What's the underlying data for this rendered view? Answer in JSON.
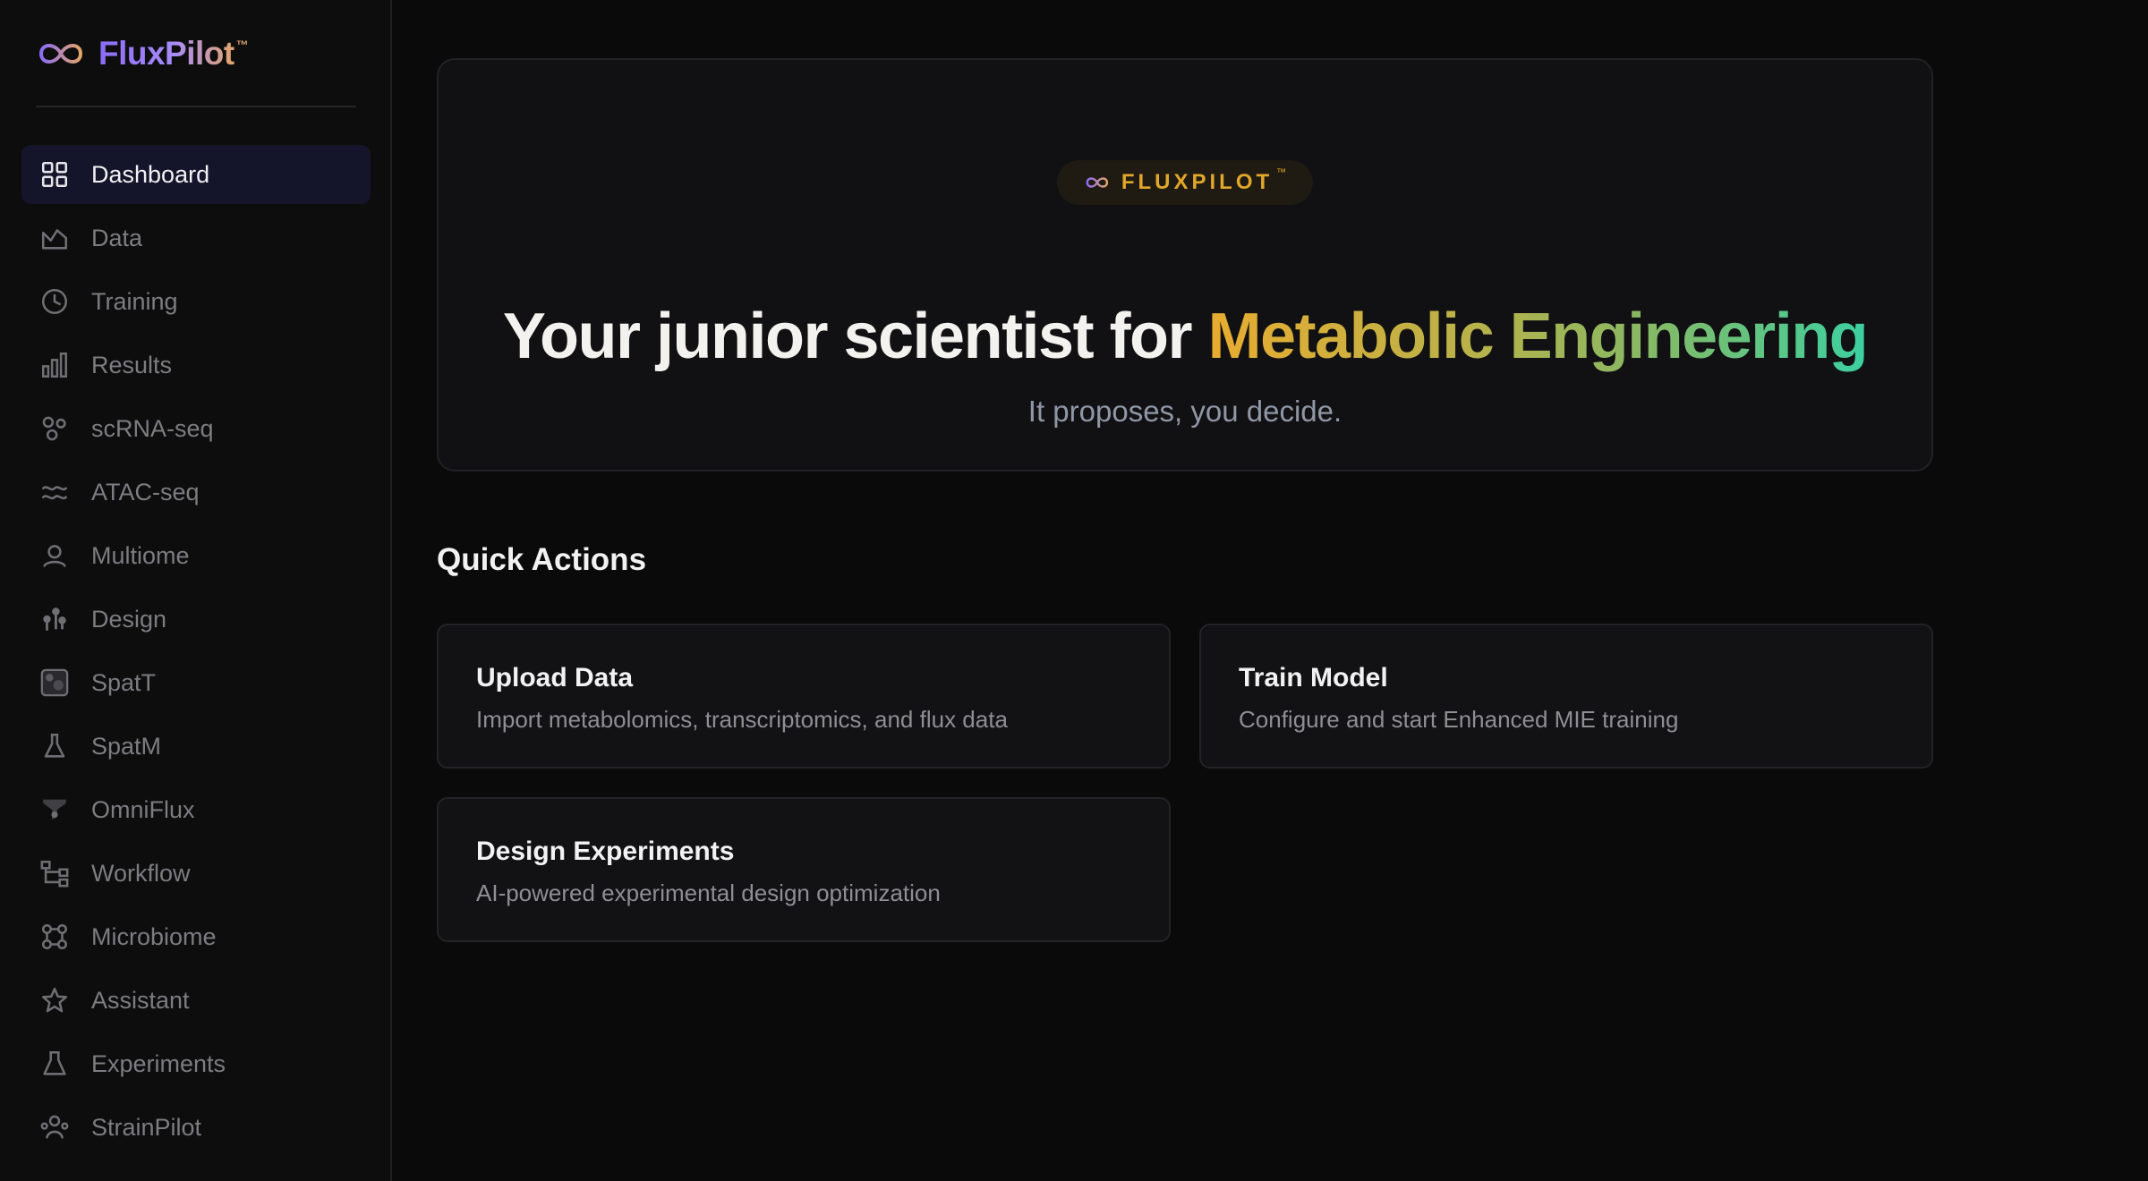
{
  "brand": {
    "name": "FluxPilot",
    "tm": "™"
  },
  "nav": [
    {
      "id": "dashboard",
      "label": "Dashboard",
      "icon": "dashboard-grid-icon",
      "active": true
    },
    {
      "id": "data",
      "label": "Data",
      "icon": "area-chart-icon"
    },
    {
      "id": "training",
      "label": "Training",
      "icon": "clock-icon"
    },
    {
      "id": "results",
      "label": "Results",
      "icon": "bar-chart-icon"
    },
    {
      "id": "scrna-seq",
      "label": "scRNA-seq",
      "icon": "cells-icon"
    },
    {
      "id": "atac-seq",
      "label": "ATAC-seq",
      "icon": "waves-icon"
    },
    {
      "id": "multiome",
      "label": "Multiome",
      "icon": "user-circle-icon"
    },
    {
      "id": "design",
      "label": "Design",
      "icon": "molecule-icon"
    },
    {
      "id": "spatt",
      "label": "SpatT",
      "icon": "tissue-square-icon"
    },
    {
      "id": "spatm",
      "label": "SpatM",
      "icon": "flask-icon"
    },
    {
      "id": "omniflux",
      "label": "OmniFlux",
      "icon": "funnel-icon"
    },
    {
      "id": "workflow",
      "label": "Workflow",
      "icon": "workflow-icon"
    },
    {
      "id": "microbiome",
      "label": "Microbiome",
      "icon": "network-icon"
    },
    {
      "id": "assistant",
      "label": "Assistant",
      "icon": "star-icon"
    },
    {
      "id": "experiments",
      "label": "Experiments",
      "icon": "beaker-icon"
    },
    {
      "id": "strainpilot",
      "label": "StrainPilot",
      "icon": "users-icon"
    }
  ],
  "hero": {
    "badge": "FLUXPILOT",
    "badge_tm": "™",
    "title_prefix": "Your junior scientist for ",
    "title_highlight": "Metabolic Engineering",
    "subtitle": "It proposes, you decide."
  },
  "quick_actions": {
    "title": "Quick Actions",
    "cards": [
      {
        "title": "Upload Data",
        "description": "Import metabolomics, transcriptomics, and flux data"
      },
      {
        "title": "Train Model",
        "description": "Configure and start Enhanced MIE training"
      },
      {
        "title": "Design Experiments",
        "description": "AI-powered experimental design optimization"
      }
    ]
  },
  "colors": {
    "accent_purple": "#8b6cf6",
    "accent_gold": "#e8ac30",
    "accent_green": "#3cd0a0",
    "active_nav_bg": "#14142a"
  }
}
